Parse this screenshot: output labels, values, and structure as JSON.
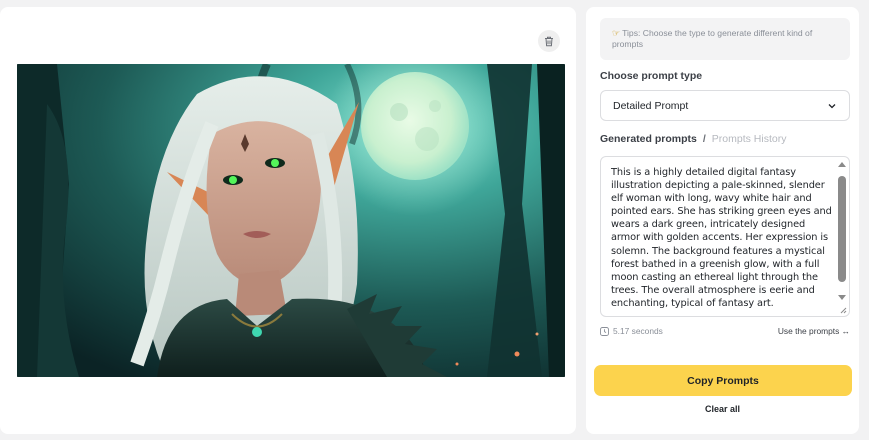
{
  "left": {
    "image_alt": "Fantasy elf woman with white hair and green eyes in a moonlit forest"
  },
  "right": {
    "tips_text": "Tips: Choose the type to generate different kind of prompts",
    "choose_label": "Choose prompt type",
    "select_value": "Detailed Prompt",
    "tab_generated": "Generated prompts",
    "tab_separator": "/",
    "tab_history": "Prompts History",
    "prompt_text": "This is a highly detailed digital fantasy illustration depicting a pale-skinned, slender elf woman with long, wavy white hair and pointed ears. She has striking green eyes and wears a dark green, intricately designed armor with golden accents. Her expression is solemn. The background features a mystical forest bathed in a greenish glow, with a full moon casting an ethereal light through the trees. The overall atmosphere is eerie and enchanting, typical of fantasy art.",
    "time_text": "5.17 seconds",
    "use_prompts": "Use the prompts ↔",
    "copy_button": "Copy Prompts",
    "clear_all": "Clear all"
  },
  "colors": {
    "accent": "#fcd34d",
    "background": "#f2f2f3"
  }
}
